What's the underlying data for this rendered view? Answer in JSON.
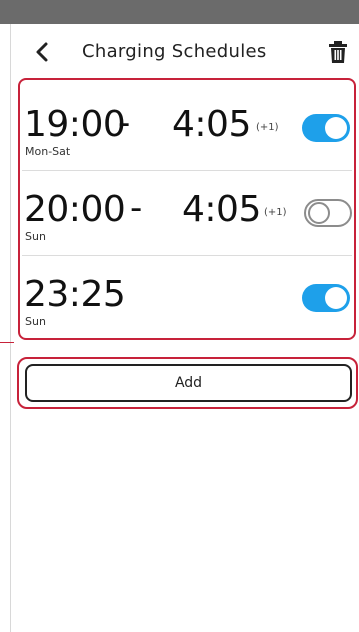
{
  "header": {
    "title": "Charging Schedules"
  },
  "schedules": [
    {
      "start": "19:00",
      "dash": "-",
      "end": "4:05",
      "next_day": "(+1)",
      "days": "Mon-Sat",
      "enabled": true
    },
    {
      "start": "20:00",
      "dash": "-",
      "end": "4:05",
      "next_day": "(+1)",
      "days": "Sun",
      "enabled": false
    },
    {
      "start": "23:25",
      "days": "Sun",
      "enabled": true
    }
  ],
  "actions": {
    "add_label": "Add"
  },
  "colors": {
    "accent": "#1ea0ea",
    "highlight": "#c7223a"
  },
  "icons": {
    "back": "chevron-left-icon",
    "delete": "trash-icon"
  }
}
